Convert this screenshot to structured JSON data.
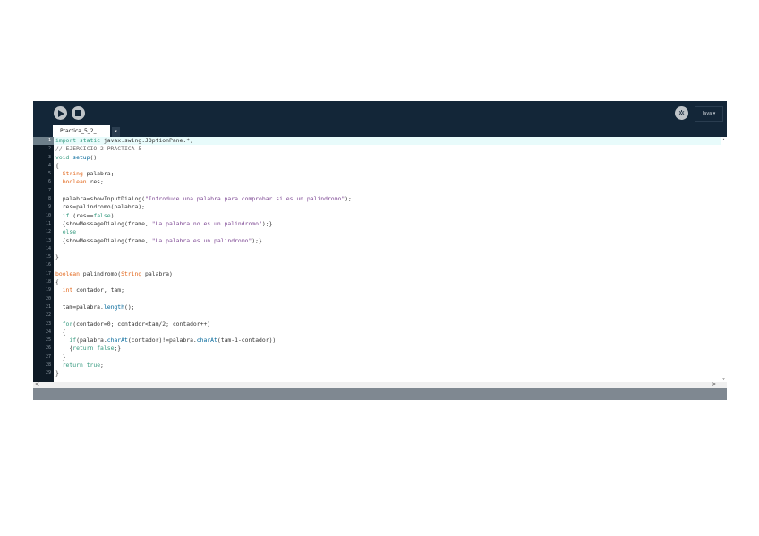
{
  "toolbar": {
    "run": "run",
    "stop": "stop",
    "mode_label": "Java ▾"
  },
  "tabs": [
    {
      "label": "Practica_5_2_"
    }
  ],
  "tab_menu": "▾",
  "editor": {
    "current_line": 1,
    "lines": [
      [
        [
          "import static",
          "kw2"
        ],
        [
          " javax.swing.JOptionPane.*;",
          ""
        ]
      ],
      [
        [
          "// EJERCICIO 2 PRACTICA 5",
          "com"
        ]
      ],
      [
        [
          "void",
          "kw2"
        ],
        [
          " ",
          ""
        ],
        [
          "setup",
          "fn"
        ],
        [
          "()",
          ""
        ]
      ],
      [
        [
          "{",
          ""
        ]
      ],
      [
        [
          "  ",
          ""
        ],
        [
          "String",
          "kw"
        ],
        [
          " palabra;",
          ""
        ]
      ],
      [
        [
          "  ",
          ""
        ],
        [
          "boolean",
          "kw"
        ],
        [
          " res;",
          ""
        ]
      ],
      [],
      [
        [
          "  palabra=showInputDialog(",
          ""
        ],
        [
          "\"Introduce una palabra para comprobar si es un palindromo\"",
          "str"
        ],
        [
          ");",
          ""
        ]
      ],
      [
        [
          "  res=palindromo(palabra);",
          ""
        ]
      ],
      [
        [
          "  ",
          ""
        ],
        [
          "if",
          "kw2"
        ],
        [
          " (res==",
          ""
        ],
        [
          "false",
          "kw2"
        ],
        [
          ")",
          ""
        ]
      ],
      [
        [
          "  {showMessageDialog(frame, ",
          ""
        ],
        [
          "\"La palabra no es un palindromo\"",
          "str"
        ],
        [
          ");}",
          ""
        ]
      ],
      [
        [
          "  ",
          ""
        ],
        [
          "else",
          "kw2"
        ]
      ],
      [
        [
          "  {showMessageDialog(frame, ",
          ""
        ],
        [
          "\"La palabra es un palindromo\"",
          "str"
        ],
        [
          ");}",
          ""
        ]
      ],
      [],
      [
        [
          "}",
          ""
        ]
      ],
      [],
      [
        [
          "boolean",
          "kw"
        ],
        [
          " palindromo(",
          ""
        ],
        [
          "String",
          "kw"
        ],
        [
          " palabra)",
          ""
        ]
      ],
      [
        [
          "{",
          ""
        ]
      ],
      [
        [
          "  ",
          ""
        ],
        [
          "int",
          "kw"
        ],
        [
          " contador, tam;",
          ""
        ]
      ],
      [],
      [
        [
          "  tam=palabra.",
          ""
        ],
        [
          "length",
          "fn"
        ],
        [
          "();",
          ""
        ]
      ],
      [],
      [
        [
          "  ",
          ""
        ],
        [
          "for",
          "kw2"
        ],
        [
          "(contador=0; contador<tam/2; contador++)",
          ""
        ]
      ],
      [
        [
          "  {",
          ""
        ]
      ],
      [
        [
          "    ",
          ""
        ],
        [
          "if",
          "kw2"
        ],
        [
          "(palabra.",
          ""
        ],
        [
          "charAt",
          "fn"
        ],
        [
          "(contador)!=palabra.",
          ""
        ],
        [
          "charAt",
          "fn"
        ],
        [
          "(tam-1-contador))",
          ""
        ]
      ],
      [
        [
          "    {",
          ""
        ],
        [
          "return",
          "kw2"
        ],
        [
          " ",
          ""
        ],
        [
          "false",
          "kw2"
        ],
        [
          ";}",
          ""
        ]
      ],
      [
        [
          "  }",
          ""
        ]
      ],
      [
        [
          "  ",
          ""
        ],
        [
          "return",
          "kw2"
        ],
        [
          " ",
          ""
        ],
        [
          "true",
          "kw2"
        ],
        [
          ";",
          ""
        ]
      ],
      [
        [
          "}",
          ""
        ]
      ]
    ]
  },
  "scroll": {
    "up": "▴",
    "down": "▾",
    "left": "<",
    "right": ">"
  }
}
